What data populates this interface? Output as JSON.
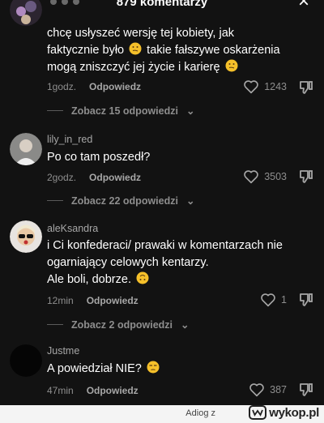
{
  "header": {
    "title": "879 komentarzy",
    "close_label": "×"
  },
  "comments": [
    {
      "author": "",
      "text_line1": "chcę usłyszeć wersję tej kobiety, jak",
      "text_line2_a": "faktycznie było ",
      "text_line2_b": " takie fałszywe oskarżenia",
      "text_line3": "mogą zniszczyć jej życie i karierę ",
      "time": "1godz.",
      "reply": "Odpowiedz",
      "likes": "1243",
      "replies_toggle": "Zobacz 15 odpowiedzi"
    },
    {
      "author": "lily_in_red",
      "text": "Po co tam poszedł?",
      "time": "2godz.",
      "reply": "Odpowiedz",
      "likes": "3503",
      "replies_toggle": "Zobacz 22 odpowiedzi"
    },
    {
      "author": "aleKsandra",
      "text_line1": "i Ci konfederaci/ prawaki w komentarzach nie",
      "text_line2": "ogarniający celowych kentarzy.",
      "text_line3": "Ale boli, dobrze. ",
      "time": "12min",
      "reply": "Odpowiedz",
      "likes": "1",
      "replies_toggle": "Zobacz 2 odpowiedzi"
    },
    {
      "author": "Justme",
      "text": "A powiedział NIE? ",
      "time": "47min",
      "reply": "Odpowiedz",
      "likes": "387"
    }
  ],
  "footer": {
    "user": "Adiog z",
    "brand": "wykop.pl"
  },
  "colors": {
    "background": "#121212",
    "text": "#ffffff",
    "muted": "#8e8e8e",
    "emoji": "#f5c02a"
  }
}
